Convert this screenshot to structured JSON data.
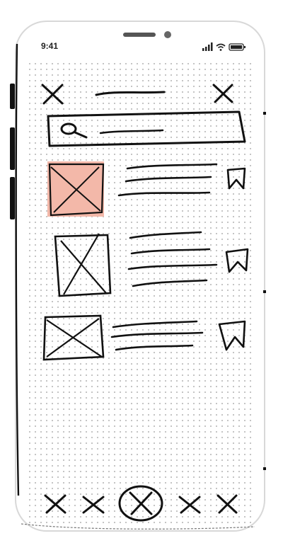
{
  "status_bar": {
    "time": "9:41",
    "icons": [
      "signal-icon",
      "wifi-icon",
      "battery-icon"
    ]
  },
  "header": {
    "left_icon": "close-icon",
    "title_placeholder": "scribble-line",
    "right_icon": "close-icon"
  },
  "search": {
    "icon": "search-icon",
    "placeholder": "scribble-line"
  },
  "list": {
    "items": [
      {
        "thumbnail": "image-placeholder",
        "highlighted": true,
        "text_lines": 3,
        "action_icon": "bookmark-icon"
      },
      {
        "thumbnail": "image-placeholder",
        "highlighted": false,
        "text_lines": 4,
        "action_icon": "bookmark-icon"
      },
      {
        "thumbnail": "image-placeholder",
        "highlighted": false,
        "text_lines": 3,
        "action_icon": "bookmark-icon"
      }
    ]
  },
  "tab_bar": {
    "items": [
      "tab-icon",
      "tab-icon",
      "home-icon-selected",
      "tab-icon",
      "tab-icon"
    ]
  },
  "colors": {
    "ink": "#111111",
    "highlight": "#f3b8a9",
    "paper": "#ffffff",
    "dot": "#9a9a9a"
  }
}
